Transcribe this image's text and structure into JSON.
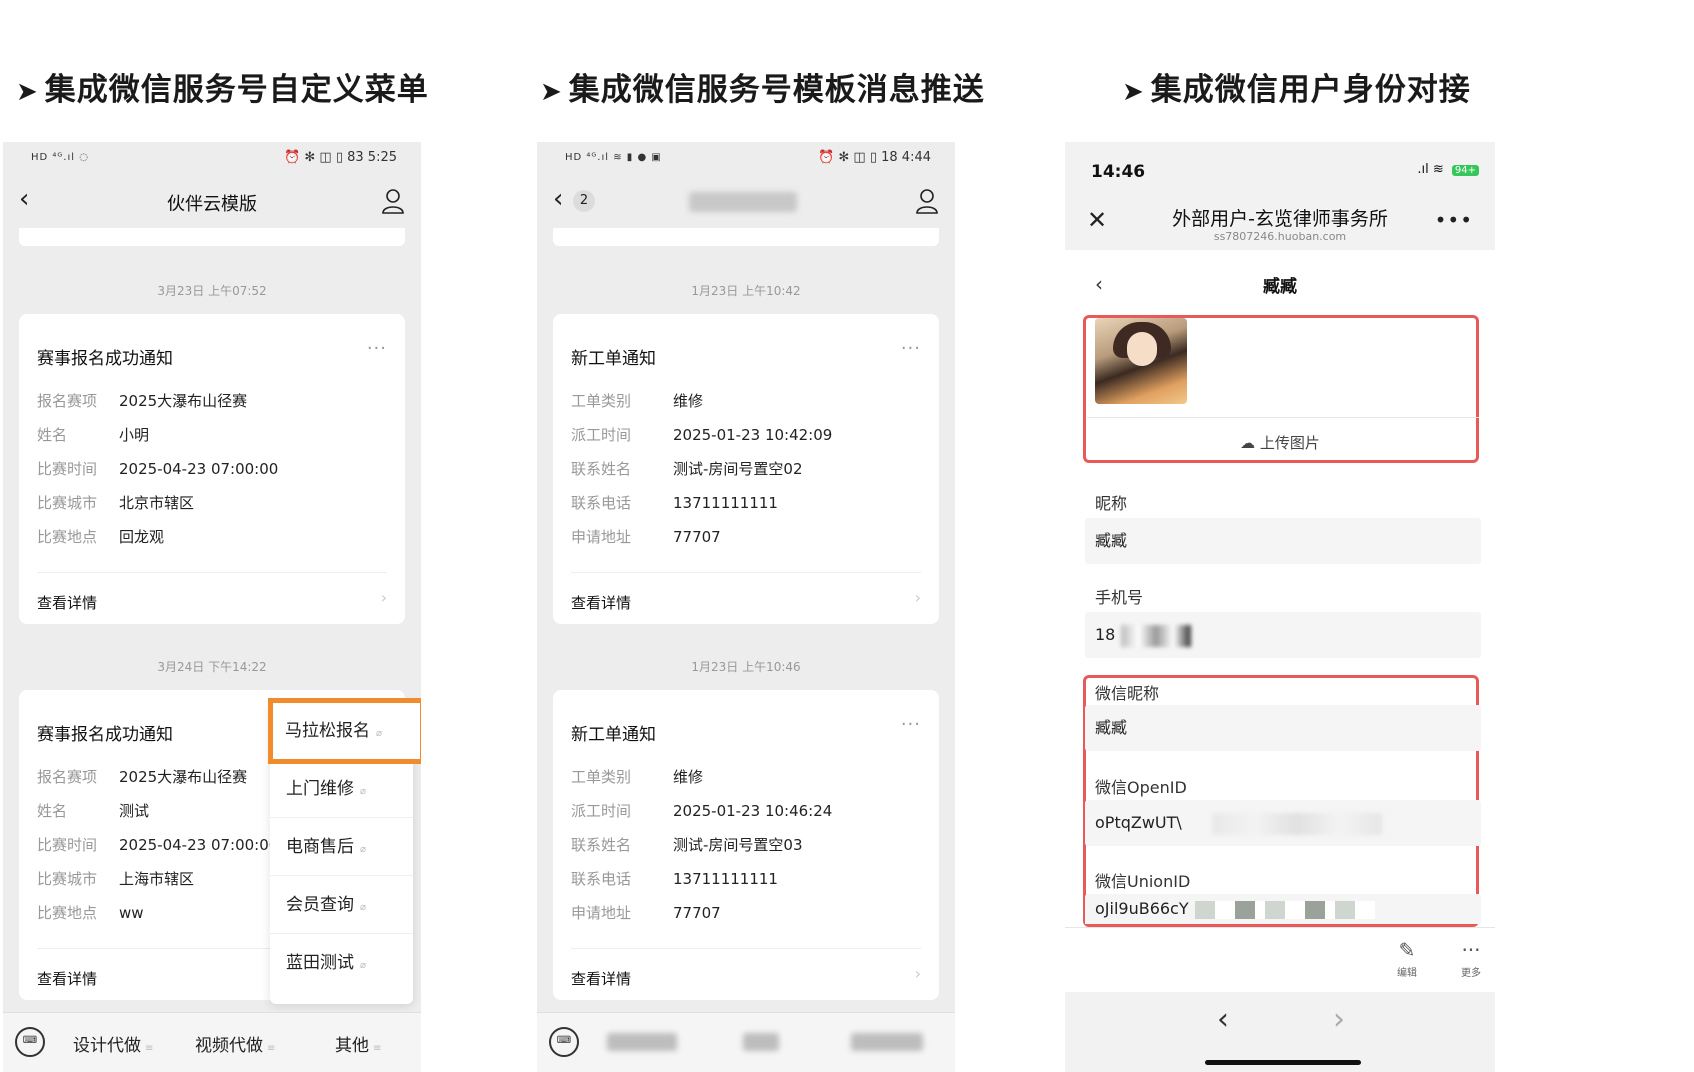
{
  "sections": [
    {
      "title": "集成微信服务号自定义菜单"
    },
    {
      "title": "集成微信服务号模板消息推送"
    },
    {
      "title": "集成微信用户身份对接"
    }
  ],
  "phone1": {
    "status_left": "HD ⁴ᴳ.ıl ◌",
    "status_right": "⏰ ✻ ◫ ▯ 83 5:25",
    "nav_title": "伙伴云模版",
    "date1": "3月23日 上午07:52",
    "date2": "3月24日 下午14:22",
    "card1": {
      "title": "赛事报名成功通知",
      "rows": [
        {
          "k": "报名赛项",
          "v": "2025大瀑布山径赛"
        },
        {
          "k": "姓名",
          "v": "小明"
        },
        {
          "k": "比赛时间",
          "v": "2025-04-23 07:00:00"
        },
        {
          "k": "比赛城市",
          "v": "北京市辖区"
        },
        {
          "k": "比赛地点",
          "v": "回龙观"
        }
      ],
      "detail": "查看详情"
    },
    "card2": {
      "title": "赛事报名成功通知",
      "rows": [
        {
          "k": "报名赛项",
          "v": "2025大瀑布山径赛"
        },
        {
          "k": "姓名",
          "v": "测试"
        },
        {
          "k": "比赛时间",
          "v": "2025-04-23 07:00:00"
        },
        {
          "k": "比赛城市",
          "v": "上海市辖区"
        },
        {
          "k": "比赛地点",
          "v": "ww"
        }
      ],
      "detail": "查看详情"
    },
    "popup": [
      "马拉松报名",
      "上门维修",
      "电商售后",
      "会员查询",
      "蓝田测试"
    ],
    "menu": [
      "设计代做",
      "视频代做",
      "其他"
    ]
  },
  "phone2": {
    "status_left": "HD ⁴ᴳ.ıl ≋ ▮ ● ▣",
    "status_right": "⏰ ✻ ◫ ▯ 18 4:44",
    "badge": "2",
    "date1": "1月23日 上午10:42",
    "date2": "1月23日 上午10:46",
    "card1": {
      "title": "新工单通知",
      "rows": [
        {
          "k": "工单类别",
          "v": "维修"
        },
        {
          "k": "派工时间",
          "v": "2025-01-23 10:42:09"
        },
        {
          "k": "联系姓名",
          "v": "测试-房间号置空02"
        },
        {
          "k": "联系电话",
          "v": "13711111111"
        },
        {
          "k": "申请地址",
          "v": "77707"
        }
      ],
      "detail": "查看详情"
    },
    "card2": {
      "title": "新工单通知",
      "rows": [
        {
          "k": "工单类别",
          "v": "维修"
        },
        {
          "k": "派工时间",
          "v": "2025-01-23 10:46:24"
        },
        {
          "k": "联系姓名",
          "v": "测试-房间号置空03"
        },
        {
          "k": "联系电话",
          "v": "13711111111"
        },
        {
          "k": "申请地址",
          "v": "77707"
        }
      ],
      "detail": "查看详情"
    }
  },
  "phone3": {
    "time": "14:46",
    "battery": "94+",
    "title": "外部用户-玄览律师事务所",
    "subtitle": "ss7807246.huoban.com",
    "name": "臧臧",
    "upload": "上传图片",
    "fields": [
      {
        "label": "昵称",
        "value": "臧臧"
      },
      {
        "label": "手机号",
        "value": "18"
      },
      {
        "label": "微信昵称",
        "value": "臧臧"
      },
      {
        "label": "微信OpenID",
        "value": "oPtqZwUT\\"
      },
      {
        "label": "微信UnionID",
        "value": "oJil9uB66cY"
      }
    ],
    "edit": "编辑",
    "more": "更多"
  },
  "colors": {
    "highlight_orange": "#f08c2c",
    "highlight_red": "#e85a5a",
    "wechat_bg": "#ededed"
  }
}
